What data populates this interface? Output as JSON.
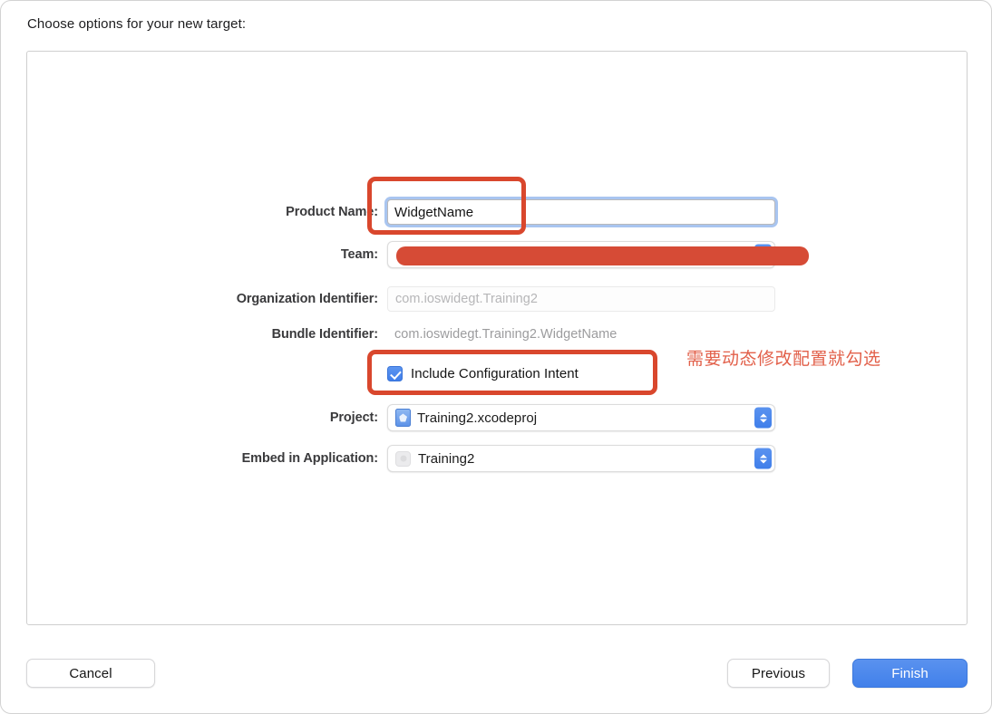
{
  "dialog": {
    "prompt": "Choose options for your new target:"
  },
  "form": {
    "rows": [
      {
        "label": "Product Name:",
        "type": "textfield-focused",
        "value": "WidgetName"
      },
      {
        "label": "Team:",
        "type": "popup-redacted",
        "value": "",
        "redacted": true
      },
      {
        "label": "Organization Identifier:",
        "type": "textfield-placeholder",
        "placeholder": "com.ioswidegt.Training2",
        "value": ""
      },
      {
        "label": "Bundle Identifier:",
        "type": "static",
        "value": "com.ioswidegt.Training2.WidgetName"
      },
      {
        "label": "",
        "type": "checkbox",
        "checkbox_label": "Include Configuration Intent",
        "checked": true
      },
      {
        "label": "Project:",
        "type": "popup",
        "value": "Training2.xcodeproj",
        "icon": "xcode-project-icon"
      },
      {
        "label": "Embed in Application:",
        "type": "popup",
        "value": "Training2",
        "icon": "app-bundle-icon"
      }
    ]
  },
  "annotations": {
    "color": "#d9472d",
    "redaction_color": "#d64b36",
    "note_text": "需要动态修改配置就勾选",
    "note_color": "#e2604a"
  },
  "footer": {
    "cancel_label": "Cancel",
    "previous_label": "Previous",
    "finish_label": "Finish"
  },
  "colors": {
    "accent_blue": "#4180ea",
    "focus_ring": "#a9c5f0"
  }
}
